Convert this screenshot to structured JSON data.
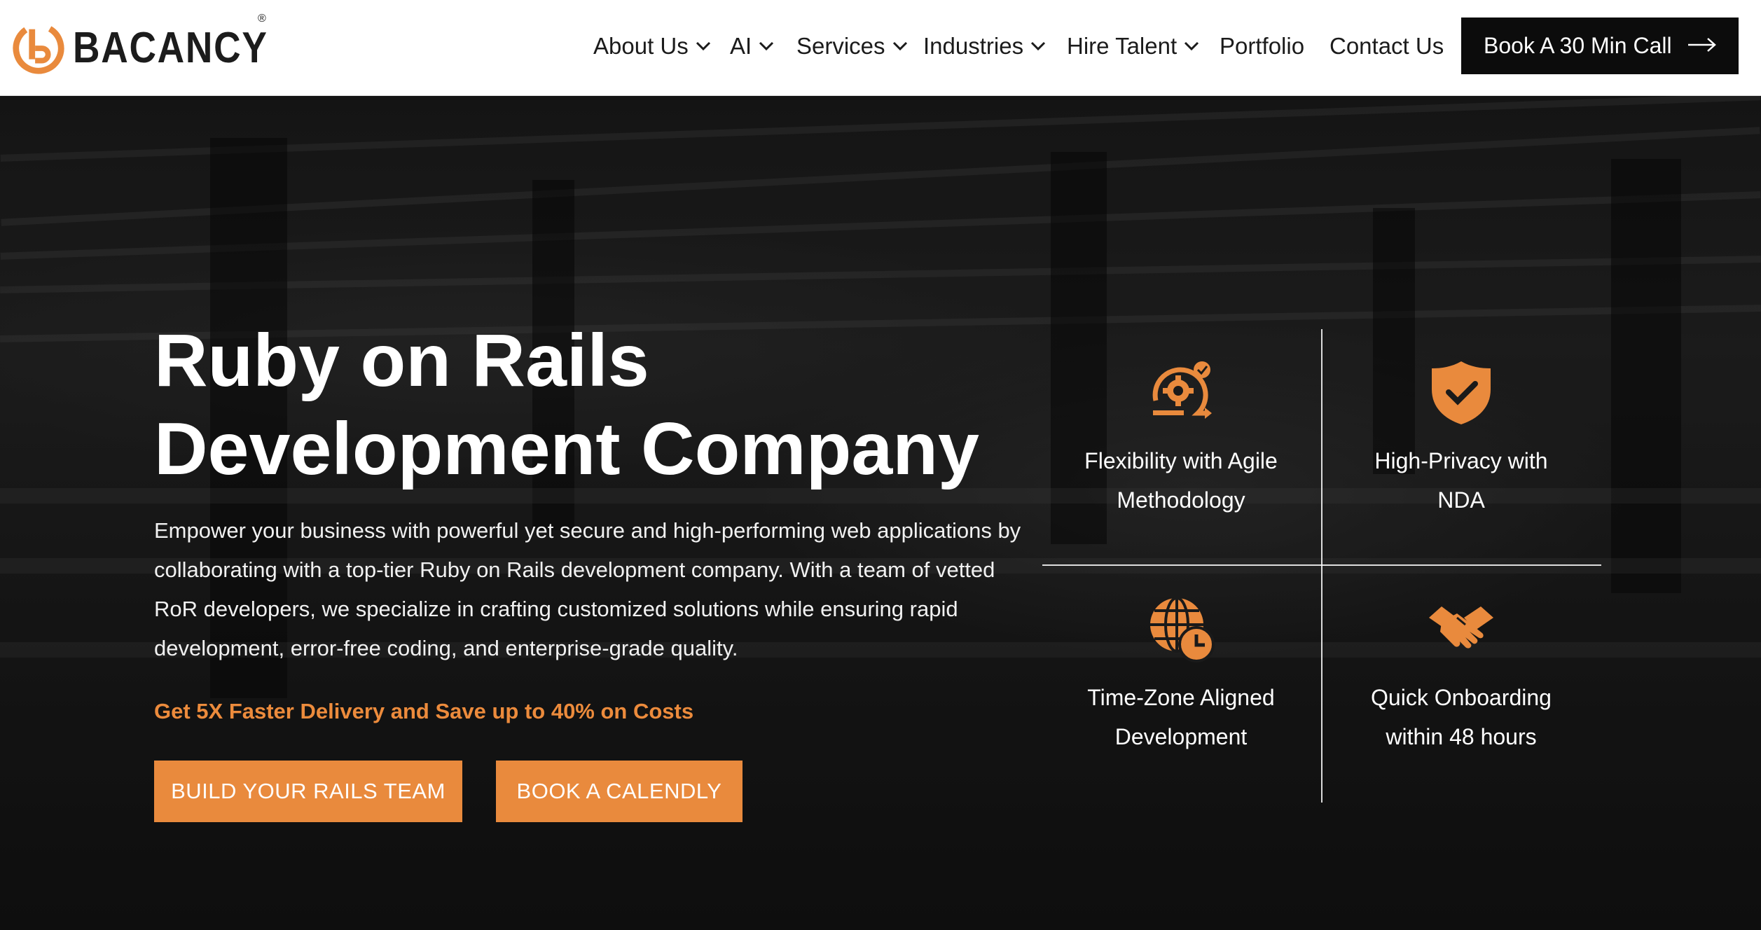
{
  "brand": {
    "name": "BACANCY",
    "registered_mark": "®",
    "accent_color": "#e98a3d",
    "logo_icon": "bacancy-logo-icon"
  },
  "nav": {
    "items": [
      {
        "label": "About Us",
        "has_dropdown": true
      },
      {
        "label": "AI",
        "has_dropdown": true
      },
      {
        "label": "Services",
        "has_dropdown": true
      },
      {
        "label": "Industries",
        "has_dropdown": true
      },
      {
        "label": "Hire Talent",
        "has_dropdown": true
      },
      {
        "label": "Portfolio",
        "has_dropdown": false
      },
      {
        "label": "Contact Us",
        "has_dropdown": false
      }
    ],
    "cta_label": "Book A 30 Min Call",
    "cta_icon": "arrow-right-icon"
  },
  "hero": {
    "title_line1": "Ruby on Rails",
    "title_line2": "Development Company",
    "description": "Empower your business with powerful yet secure and high-performing web applications by collaborating with a top-tier Ruby on Rails development company. With a team of vetted RoR developers, we specialize in crafting customized solutions while ensuring rapid development, error-free coding, and enterprise-grade quality.",
    "highlight": "Get 5X Faster Delivery and Save up to 40% on Costs",
    "primary_button": "BUILD YOUR RAILS TEAM",
    "secondary_button": "BOOK A CALENDLY"
  },
  "features": [
    {
      "icon": "agile-gear-icon",
      "line1": "Flexibility with Agile",
      "line2": "Methodology"
    },
    {
      "icon": "shield-check-icon",
      "line1": "High-Privacy with",
      "line2": "NDA"
    },
    {
      "icon": "globe-clock-icon",
      "line1": "Time-Zone Aligned",
      "line2": "Development"
    },
    {
      "icon": "handshake-icon",
      "line1": "Quick Onboarding",
      "line2": "within 48 hours"
    }
  ]
}
